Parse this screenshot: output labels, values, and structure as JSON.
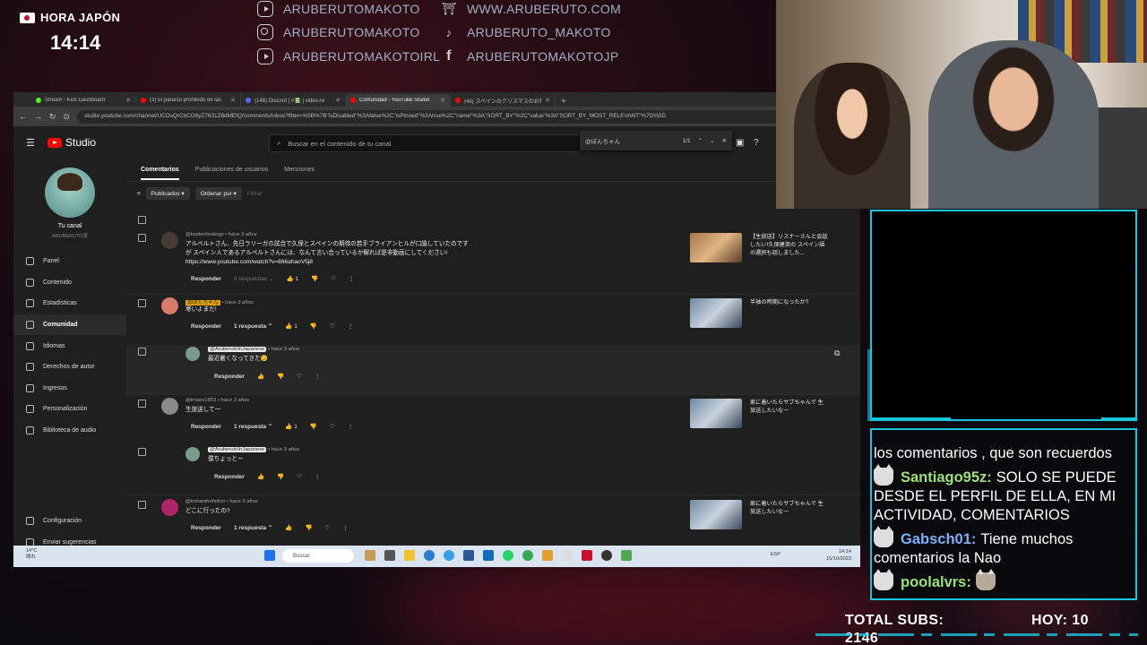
{
  "clock": {
    "label": "HORA JAPÓN",
    "time": "14:14"
  },
  "socials": {
    "left": [
      "ARUBERUTOMAKOTO",
      "ARUBERUTOMAKOTO",
      "ARUBERUTOMAKOTOIRL"
    ],
    "right": [
      "WWW.ARUBERUTO.COM",
      "ARUBERUTO_MAKOTO",
      "ARUBERUTOMAKOTOJP"
    ],
    "left_icons": [
      "youtube-icon",
      "instagram-icon",
      "youtube-icon"
    ],
    "right_icons": [
      "torii-icon",
      "tiktok-icon",
      "facebook-icon"
    ]
  },
  "browser": {
    "tabs": [
      {
        "title": "Stream - Kick Dashboard",
        "color": "#53fc18"
      },
      {
        "title": "(3) El paraíso prohibido de las",
        "color": "#ff0000"
      },
      {
        "title": "(148) Discord | #📗 | video-re",
        "color": "#5865f2"
      },
      {
        "title": "Comunidad - YouTube Studio",
        "color": "#ff0000"
      },
      {
        "title": "(46) スペインのクリスマスのお菓子",
        "color": "#ff0000"
      }
    ],
    "new_tab": "+",
    "url": "studio.youtube.com/channel/UCOsQrCbCG6yZ7631Z8dMEfQ/comments/inbox?filter=%5B%7B\"isDisabled\"%3Afalse%2C\"isPinned\"%3Atrue%2C\"name\"%3A\"SORT_BY\"%2C\"value\"%3A\"SORT_BY_MOST_RELEVANT\"%7D%5D"
  },
  "studio": {
    "logo": "Studio",
    "search_placeholder": "Buscar en el contenido de tu canal",
    "find": {
      "query": "@ぽんちゃん",
      "count": "1/1"
    },
    "channel": {
      "title": "Tu canal",
      "subtitle": "ARUBERUTO流"
    },
    "nav": [
      "Panel",
      "Contenido",
      "Estadísticas",
      "Comunidad",
      "Idiomas",
      "Derechos de autor",
      "Ingresos",
      "Personalización",
      "Biblioteca de audio"
    ],
    "nav_bottom": [
      "Configuración",
      "Enviar sugerencias"
    ],
    "tabs": [
      "Comentarios",
      "Publicaciones de usuarios",
      "Menciones"
    ],
    "filters": {
      "published": "Publicados",
      "order": "Ordenar por",
      "filter_placeholder": "Filtrar"
    },
    "reply_label": "Responder",
    "comments": [
      {
        "author": "@lowtechnology",
        "age": "hace 3 años",
        "text": "アルベルトさん、先日ラリーガの試合で久保とスペインの期待の若手ブライアンヒルが口論していたのですが スペイン人であるアルベルトさんには、なんて言い合っているか解れば是非動画にしてください! https://www.youtube.com/watch?v=866ahaoV5j8",
        "replies": "0 respuestas",
        "likes": "1",
        "video": "【生放送】リスナーさんと会話したい!久保建英の スペイン語の選択も話しました..."
      },
      {
        "author": "@ぽんちゃん",
        "age": "hace 3 años",
        "text": "寒いよまだ!",
        "replies": "1 respuesta",
        "likes": "1",
        "video": "半袖の時期になったか?"
      },
      {
        "author": "@AruberutoInJapanese",
        "age": "hace 3 años",
        "text": "最近暑くなってきた😊"
      },
      {
        "author": "@imaex1853",
        "age": "hace 3 años",
        "text": "生放送して一",
        "replies": "1 respuesta",
        "likes": "1",
        "video": "家に着いたらサブちゃんで 生放送したいなー"
      },
      {
        "author": "@AruberutoInJapanese",
        "age": "hace 3 años",
        "text": "僕ちょっとー"
      },
      {
        "author": "@irohanihohohoi",
        "age": "hace 3 años",
        "text": "どこに行ったの?",
        "replies": "1 respuesta",
        "video": "家に着いたらサブちゃんで 生放送したいなー"
      }
    ]
  },
  "taskbar": {
    "weather": "14°C",
    "weather_sub": "晴れ",
    "search": "Buscar",
    "lang": "ESP",
    "time": "14:14",
    "date": "15/10/2023"
  },
  "chat": {
    "partial": "los comentarios , que son recuerdos",
    "messages": [
      {
        "user": "Santiago95z:",
        "text": "SOLO SE PUEDE DESDE EL PERFIL DE ELLA, EN MI ACTIVIDAD, COMENTARIOS",
        "color": "#9be07a"
      },
      {
        "user": "Gabsch01:",
        "text": "Tiene muchos comentarios la Nao",
        "color": "#7fb0ff"
      },
      {
        "user": "poolalvrs:",
        "text": "",
        "color": "#9be07a"
      }
    ]
  },
  "stats": {
    "total_label": "TOTAL SUBS:",
    "total_value": "2146",
    "today_label": "HOY:",
    "today_value": "10"
  }
}
